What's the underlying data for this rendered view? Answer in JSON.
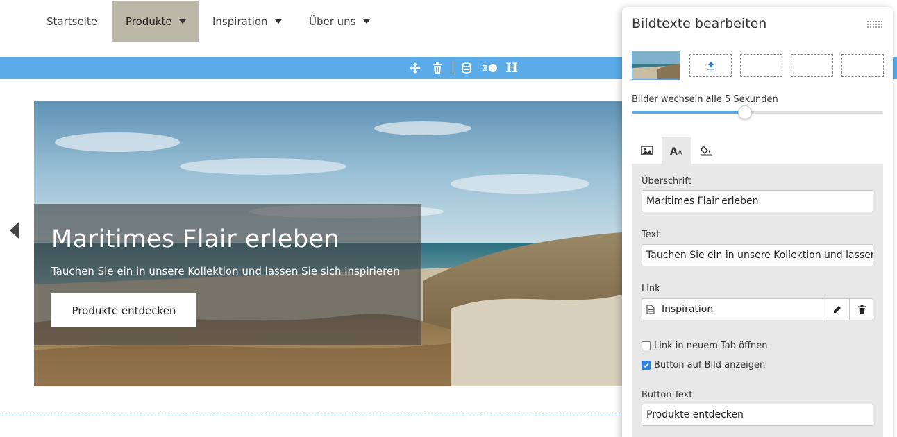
{
  "nav": {
    "items": [
      {
        "label": "Startseite",
        "has_dropdown": false
      },
      {
        "label": "Produkte",
        "has_dropdown": true,
        "active": true
      },
      {
        "label": "Inspiration",
        "has_dropdown": true
      },
      {
        "label": "Über uns",
        "has_dropdown": true
      }
    ],
    "active_bg": "#bcb8a8"
  },
  "toolbar": {
    "color": "#5aabe8",
    "icons": [
      "move-icon",
      "trash-icon",
      "database-icon",
      "toggle-icon",
      "heading-icon"
    ],
    "heading_glyph": "H"
  },
  "hero": {
    "title": "Maritimes Flair erleben",
    "subtitle": "Tauchen Sie ein in unsere Kollektion und lassen Sie sich inspirieren",
    "button_label": "Produkte entdecken"
  },
  "panel": {
    "title": "Bildtexte bearbeiten",
    "interval_label": "Bilder wechseln alle 5 Sekunden",
    "interval_seconds": 5,
    "slider_fraction": 0.45,
    "tabs": [
      "image-icon",
      "text-size-icon",
      "fill-color-icon"
    ],
    "active_tab": 1,
    "heading_label": "Überschrift",
    "heading_value": "Maritimes Flair erleben",
    "text_label": "Text",
    "text_value": "Tauchen Sie ein in unsere Kollektion und lassen Sie sich inspirieren",
    "link_label": "Link",
    "link_value": "Inspiration",
    "new_tab_label": "Link in neuem Tab öffnen",
    "new_tab_checked": false,
    "show_button_label": "Button auf Bild anzeigen",
    "show_button_checked": true,
    "button_text_label": "Button-Text",
    "button_text_value": "Produkte entdecken"
  }
}
